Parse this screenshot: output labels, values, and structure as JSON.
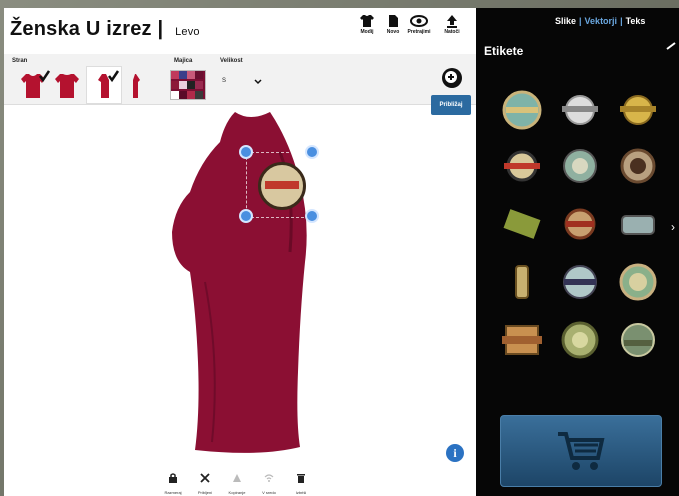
{
  "header": {
    "title": "Ženska U izrez",
    "separator": "|",
    "subtitle": "Levo"
  },
  "top_actions": [
    {
      "label": "Modij",
      "icon": "shirt-icon"
    },
    {
      "label": "Novo",
      "icon": "document-icon"
    },
    {
      "label": "Pretrajimi",
      "icon": "eye-icon"
    },
    {
      "label": "Natoči",
      "icon": "upload-icon"
    }
  ],
  "toolbar": {
    "side_label": "Stran",
    "shirt_label": "Majica",
    "size_label": "Velikost",
    "size_value": "S",
    "zoom_tooltip": "Približaj"
  },
  "bottom_actions": [
    {
      "label": "Razmeraj",
      "icon": "lock-icon"
    },
    {
      "label": "Pribljeni",
      "icon": "close-icon"
    },
    {
      "label": "Kopiranje",
      "icon": "warning-icon"
    },
    {
      "label": "V sredo",
      "icon": "wifi-icon"
    },
    {
      "label": "Izbriši",
      "icon": "trash-icon"
    }
  ],
  "right_panel": {
    "tabs": [
      "Slike",
      "Vektorji",
      "Teks"
    ],
    "active_tab": "Vektorji",
    "heading": "Etikete"
  },
  "colors": {
    "garment": "#8b0f33",
    "accent": "#2b72c2",
    "panel_bg": "#060606"
  }
}
